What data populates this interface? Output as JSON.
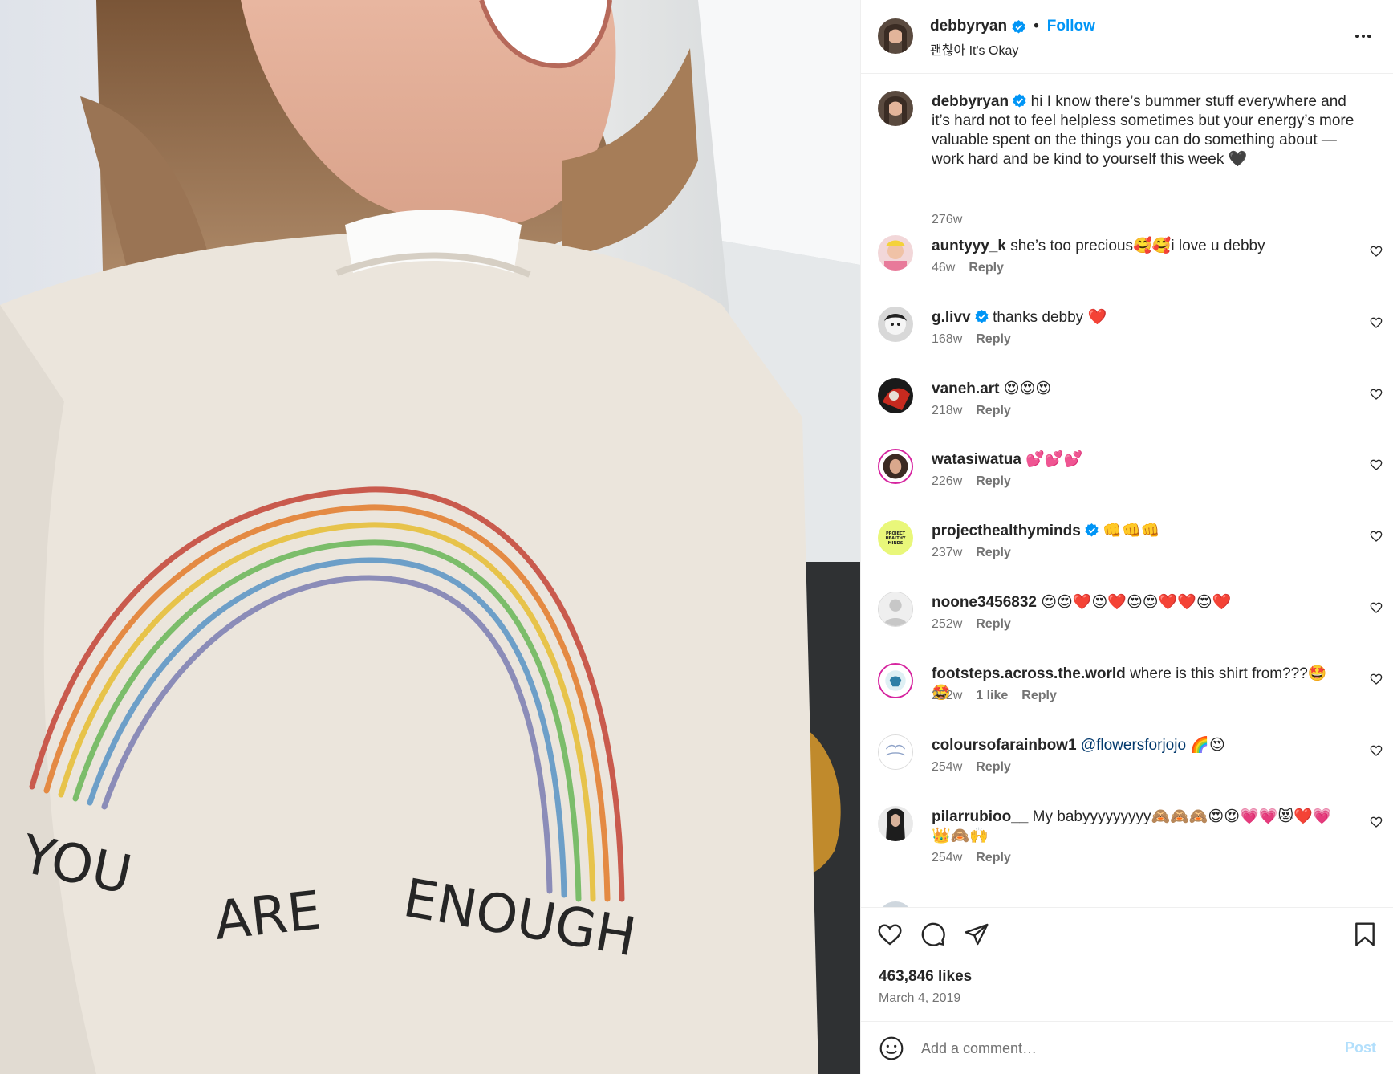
{
  "header": {
    "username": "debbyryan",
    "follow_label": "Follow",
    "dot": "•",
    "subtitle": "괜찮아 It's Okay"
  },
  "photo": {
    "shirt_text_1": "YOU",
    "shirt_text_2": "ARE",
    "shirt_text_3": "ENOUGH"
  },
  "caption": {
    "username": "debbyryan",
    "text": "hi I know there’s bummer stuff everywhere and it’s hard not to feel helpless sometimes but your energy’s more valuable spent on the things you can do something about —",
    "text2": "work hard and be kind to yourself this week 🖤",
    "age": "276w"
  },
  "reply_label": "Reply",
  "comments": [
    {
      "username": "auntyyy_k",
      "text": "she’s too precious🥰🥰i love u debby",
      "age": "46w"
    },
    {
      "username": "g.livv",
      "text": "thanks debby ❤️",
      "age": "168w"
    },
    {
      "username": "vaneh.art",
      "text": "😍😍😍",
      "age": "218w"
    },
    {
      "username": "watasiwatua",
      "text": "💕💕💕",
      "age": "226w"
    },
    {
      "username": "projecthealthyminds",
      "text": "👊👊👊",
      "age": "237w"
    },
    {
      "username": "noone3456832",
      "text": "😍😍❤️😍❤️😍😍❤️❤️😍❤️",
      "age": "252w"
    },
    {
      "username": "footsteps.across.the.world",
      "text": "where is this shirt from???🤩🤩",
      "age": "252w",
      "likes": "1 like"
    },
    {
      "username": "coloursofarainbow1",
      "mention": "@flowersforjojo",
      "text": "🌈😍",
      "age": "254w"
    },
    {
      "username": "pilarrubioo__",
      "text": "My babyyyyyyyyy🙈🙈🙈😍😍💗💗😻❤️💗👑🙈🙌",
      "age": "254w"
    }
  ],
  "avatar_labels": {
    "projecthealthyminds": "PROJECT HEALTHY MINDS"
  },
  "actions": {
    "likes": "463,846 likes",
    "date": "March 4, 2019"
  },
  "add_comment": {
    "placeholder": "Add a comment…",
    "post_label": "Post"
  },
  "colors": {
    "accent": "#0095f6",
    "post_disabled": "#b2dffc",
    "secondary_text": "#737373",
    "border": "#efefef"
  }
}
